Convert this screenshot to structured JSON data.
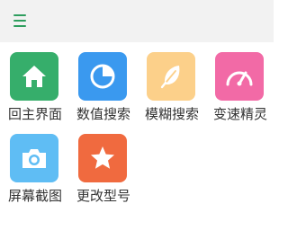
{
  "toolbar": {
    "menu_icon": "hamburger-menu-icon",
    "accent_color": "#2e9e5e"
  },
  "grid": {
    "items": [
      {
        "label": "回主界面",
        "icon": "home-icon",
        "color": "#36ae6b"
      },
      {
        "label": "数值搜索",
        "icon": "pie-chart-icon",
        "color": "#3a99ef"
      },
      {
        "label": "模糊搜索",
        "icon": "feather-icon",
        "color": "#fcd08a"
      },
      {
        "label": "变速精灵",
        "icon": "speedometer-icon",
        "color": "#f26aa6"
      },
      {
        "label": "屏幕截图",
        "icon": "camera-icon",
        "color": "#5fbdf4"
      },
      {
        "label": "更改型号",
        "icon": "star-icon",
        "color": "#f06a3f"
      }
    ]
  }
}
